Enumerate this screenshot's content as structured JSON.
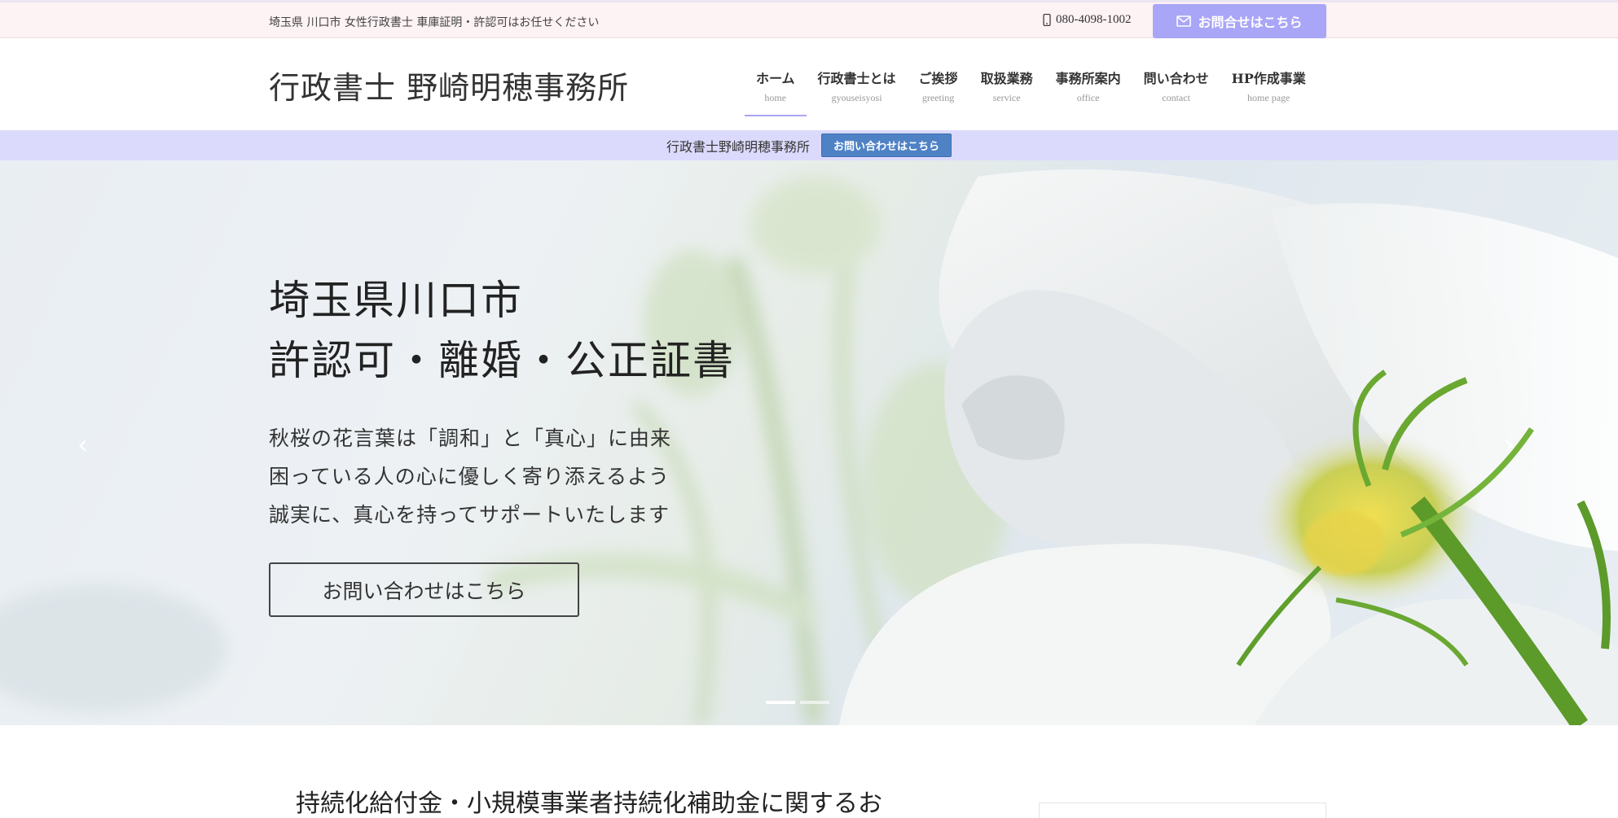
{
  "topbar": {
    "tagline": "埼玉県 川口市 女性行政書士 車庫証明・許認可はお任せください",
    "phone": "080-4098-1002",
    "contact_button": "お問合せはこちら"
  },
  "header": {
    "logo": "行政書士 野崎明穂事務所",
    "nav": [
      {
        "jp": "ホーム",
        "en": "home"
      },
      {
        "jp": "行政書士とは",
        "en": "gyouseisyosi"
      },
      {
        "jp": "ご挨拶",
        "en": "greeting"
      },
      {
        "jp": "取扱業務",
        "en": "service"
      },
      {
        "jp": "事務所案内",
        "en": "office"
      },
      {
        "jp": "問い合わせ",
        "en": "contact"
      },
      {
        "jp": "HP作成事業",
        "en": "home page"
      }
    ]
  },
  "notice": {
    "label": "行政書士野崎明穂事務所",
    "button": "お問い合わせはこちら"
  },
  "hero": {
    "title_line1": "埼玉県川口市",
    "title_line2": "許認可・離婚・公正証書",
    "sub_line1": "秋桜の花言葉は「調和」と「真心」に由来",
    "sub_line2": "困っている人の心に優しく寄り添えるよう",
    "sub_line3": "誠実に、真心を持ってサポートいたします",
    "cta": "お問い合わせはこちら",
    "prev_arrow": "‹",
    "next_arrow": "›"
  },
  "article": {
    "title": "持続化給付金・小規模事業者持続化補助金に関するお"
  },
  "colors": {
    "accent": "#a9a5f7",
    "notice_bg": "#dcdafc",
    "notice_button": "#4f82c5",
    "topbar_bg": "#fdf2f4"
  }
}
